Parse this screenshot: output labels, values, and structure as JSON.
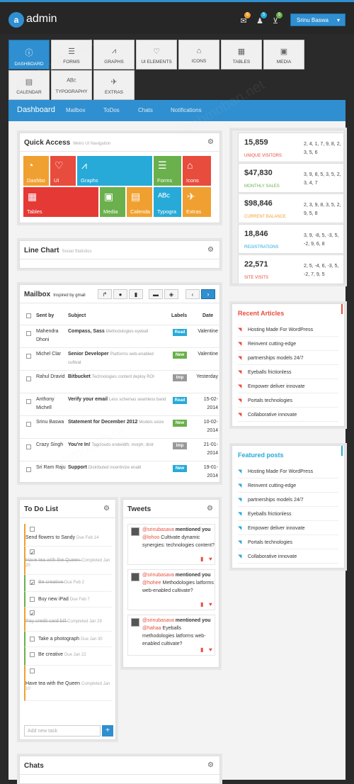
{
  "header": {
    "brand": "admin",
    "logo": "a",
    "user": "Srinu Baswa",
    "badges": [
      "5",
      "5",
      "5"
    ]
  },
  "nav": [
    {
      "label": "DASHBOARD",
      "icon": "ⓘ",
      "active": true
    },
    {
      "label": "FORMS",
      "icon": "☰"
    },
    {
      "label": "GRAPHS",
      "icon": "⩘"
    },
    {
      "label": "UI ELEMENTS",
      "icon": "♡"
    },
    {
      "label": "ICONS",
      "icon": "⌂"
    },
    {
      "label": "TABLES",
      "icon": "▦"
    },
    {
      "label": "MEDIA",
      "icon": "▣"
    },
    {
      "label": "CALENDAR",
      "icon": "▤"
    },
    {
      "label": "TYPOGRAPHY",
      "icon": "ᴬᴮᶜ"
    },
    {
      "label": "EXTRAS",
      "icon": "✈"
    }
  ],
  "subnav": [
    "Dashboard",
    "Mailbox",
    "ToDos",
    "Chats",
    "Notifications"
  ],
  "quick": {
    "title": "Quick Access",
    "subtitle": "Metro UI Navigation",
    "tiles": [
      {
        "label": "Dashbo",
        "color": "#f0a030",
        "icon": "◔"
      },
      {
        "label": "UI",
        "color": "#e84c3d",
        "icon": "♡"
      },
      {
        "label": "Graphs",
        "color": "#27aad8",
        "icon": "⩘"
      },
      {
        "label": "Forms",
        "color": "#6ab04c",
        "icon": "☰"
      },
      {
        "label": "Icons",
        "color": "#e84c3d",
        "icon": "⌂"
      },
      {
        "label": "Tables",
        "color": "#e53935",
        "icon": "▦"
      },
      {
        "label": "Media",
        "color": "#6ab04c",
        "icon": "▣"
      },
      {
        "label": "Calenda",
        "color": "#f0a030",
        "icon": "▤"
      },
      {
        "label": "Typogra",
        "color": "#27aad8",
        "icon": "ᴬᴮᶜ"
      },
      {
        "label": "Extras",
        "color": "#f0a030",
        "icon": "✈"
      }
    ]
  },
  "line_chart": {
    "title": "Line Chart",
    "subtitle": "Social Statistics"
  },
  "stats": [
    {
      "value": "15,859",
      "label": "UNIQUE VISITORS",
      "color": "#e84c3d",
      "nums": "2, 4, 1, 7, 9, 8, 2, 3, 5, 6"
    },
    {
      "value": "$47,830",
      "label": "MONTHLY SALES",
      "color": "#6ab04c",
      "nums": "3, 9, 8, 5, 3, 5, 2, 3, 4, 7"
    },
    {
      "value": "$98,846",
      "label": "CURRENT BALANCE",
      "color": "#f0a030",
      "nums": "2, 3, 9, 8, 3, 5, 2, 9, 5, 8"
    },
    {
      "value": "18,846",
      "label": "REGISTRATIONS",
      "color": "#27aad8",
      "nums": "3, 9, -8, 5, -3, 5, -2, 9, 6, 8"
    },
    {
      "value": "22,571",
      "label": "SITE VISITS",
      "color": "#e84c3d",
      "nums": "2, 5, -4, 6, -3, 5, -2, 7, 9, 5"
    }
  ],
  "mailbox": {
    "title": "Mailbox",
    "subtitle": "Inspired by gmail",
    "headers": [
      "Sent by",
      "Subject",
      "Labels",
      "Date"
    ],
    "rows": [
      {
        "from": "Mahendra Dhoni",
        "subject": "Compass, Sass",
        "preview": "Methodologies eyeball",
        "label": "Read",
        "lcolor": "#27aad8",
        "date": "Valentine"
      },
      {
        "from": "Michel Clar",
        "subject": "Senior Developer",
        "preview": "Platforms web-enabled cultivat",
        "label": "New",
        "lcolor": "#6ab04c",
        "date": "Valentine"
      },
      {
        "from": "Rahul Dravid",
        "subject": "Bitbucket",
        "preview": "Technologies content deploy ROI",
        "label": "Imp",
        "lcolor": "#999",
        "date": "Yesterday"
      },
      {
        "from": "Anthony Michell",
        "subject": "Verify your email",
        "preview": "Less schemas seamless band",
        "label": "Read",
        "lcolor": "#27aad8",
        "date": "15-02-2014"
      },
      {
        "from": "Srinu Baswa",
        "subject": "Statement for December 2012",
        "preview": "Models seize",
        "label": "New",
        "lcolor": "#6ab04c",
        "date": "10-02-2014"
      },
      {
        "from": "Crazy Singh",
        "subject": "You're In!",
        "preview": "Tagclouds endwidth; morph; distr",
        "label": "Imp",
        "lcolor": "#999",
        "date": "21-01-2014"
      },
      {
        "from": "Sri Ram Raju",
        "subject": "Support",
        "preview": "Distributed incentivize enabl",
        "label": "New",
        "lcolor": "#27aad8",
        "date": "19-01-2014"
      }
    ]
  },
  "articles": {
    "title": "Recent Articles",
    "items": [
      "Hosting Made For WordPress",
      "Reinvent cutting-edge",
      "partnerships models 24/7",
      "Eyeballs frictionless",
      "Empower deliver innovate",
      "Portals technologies",
      "Collaborative innovate"
    ]
  },
  "featured": {
    "title": "Featured posts",
    "items": [
      "Hosting Made For WordPress",
      "Reinvent cutting-edge",
      "partnerships models 24/7",
      "Eyeballs frictionless",
      "Empower deliver innovate",
      "Portals technologies",
      "Collaborative innovate"
    ]
  },
  "todo": {
    "title": "To Do List",
    "items": [
      {
        "text": "Send flowers to Sandy",
        "meta": "Due Feb 14",
        "done": false
      },
      {
        "text": "Have tea with the Queen",
        "meta": "Completed Jan 20",
        "done": true
      },
      {
        "text": "Be creative",
        "meta": "Due Feb 2",
        "done": true
      },
      {
        "text": "Buy new iPad",
        "meta": "Due Feb 7",
        "done": false
      },
      {
        "text": "Pay credit card bill",
        "meta": "Completed Jan 29",
        "done": true
      },
      {
        "text": "Take a photograph",
        "meta": "Due Jan 30",
        "done": false
      },
      {
        "text": "Be creative",
        "meta": "Due Jan 22",
        "done": false
      },
      {
        "text": "Have tea with the Queen",
        "meta": "Completed Jan 10",
        "done": false
      }
    ],
    "placeholder": "Add new task",
    "add": "+"
  },
  "tweets": {
    "title": "Tweets",
    "items": [
      {
        "user": "@srinubasava",
        "action": "mentioned you",
        "mention": "@lohoo",
        "text": "Cultivate dynamic synergies: technologies content?"
      },
      {
        "user": "@srinubasava",
        "action": "mentioned you",
        "mention": "@hohee",
        "text": "Methodologies latforms web-enabled cultivate?"
      },
      {
        "user": "@srinubasava",
        "action": "mentioned you",
        "mention": "@hahaa",
        "text": "Eyeballs methodologies latforms web-enabled cultivate?"
      }
    ]
  },
  "chats": {
    "title": "Chats"
  },
  "watermark": "webmoban.net",
  "colors": {
    "accent": "#2f8fd0",
    "red": "#e84c3d",
    "green": "#6ab04c",
    "orange": "#f0a030",
    "cyan": "#27aad8"
  }
}
